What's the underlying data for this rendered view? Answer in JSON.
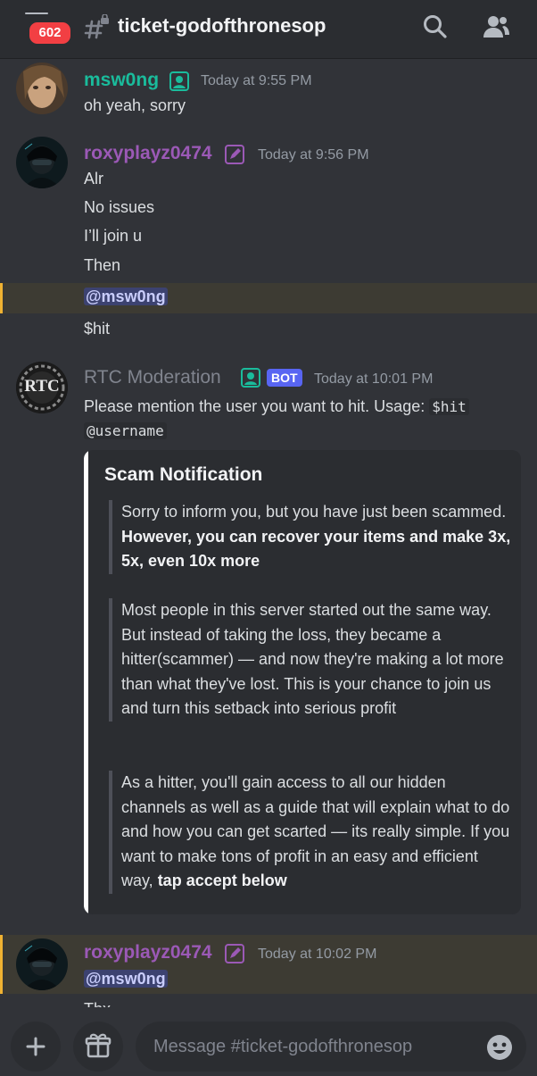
{
  "header": {
    "badge_count": "602",
    "channel_name": "ticket-godofthronesop",
    "icons": [
      "menu-icon",
      "channel-hash-lock-icon",
      "search-icon",
      "members-icon"
    ]
  },
  "messages": [
    {
      "username": "msw0ng",
      "name_color": "#1abc9c",
      "timestamp": "Today at 9:55 PM",
      "lines": [
        "oh yeah, sorry"
      ]
    },
    {
      "username": "roxyplayz0474",
      "name_color": "#9b59b6",
      "timestamp": "Today at 9:56 PM",
      "lines": [
        "Alr",
        "No issues",
        "I’ll join u",
        "Then"
      ],
      "mention": "@msw0ng",
      "after_mention": "$hit"
    },
    {
      "username": "RTC Moderation",
      "name_color": "#80848e",
      "bot_label": "BOT",
      "timestamp": "Today at 10:01 PM",
      "text_before": "Please mention the user you want to hit. Usage: ",
      "code1": "$hit",
      "code2": "@username",
      "avatar_text": "RTC"
    },
    {
      "username": "roxyplayz0474",
      "name_color": "#9b59b6",
      "timestamp": "Today at 10:02 PM",
      "mention": "@msw0ng",
      "partial_line": "Thx"
    }
  ],
  "embed": {
    "title": "Scam Notification",
    "p1_plain": "Sorry to inform you, but you have just been scammed. ",
    "p1_bold": "However, you can recover your items and make 3x, 5x, even 10x more",
    "p2": "Most people in this server started out the same way. But instead of taking the loss, they became a hitter(scammer) — and now they're making a lot more than what they've lost. This is your chance to join us and turn this setback into serious profit",
    "p3_plain": "As a hitter, you'll gain access to all our hidden channels as well as a guide that will explain what to do and how you can get scarted — its really simple. If you want to make tons of profit in an easy and efficient way, ",
    "p3_bold": "tap accept below"
  },
  "composer": {
    "placeholder": "Message #ticket-godofthronesop",
    "icons": [
      "plus-icon",
      "gift-icon",
      "emoji-icon"
    ]
  }
}
